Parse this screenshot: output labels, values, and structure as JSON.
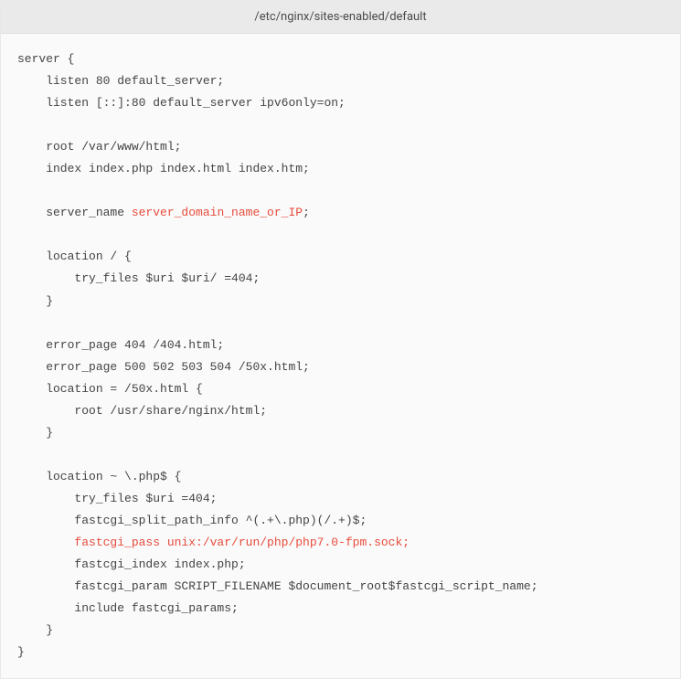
{
  "file_path": "/etc/nginx/sites-enabled/default",
  "code": {
    "line1": "server {",
    "line2": "    listen 80 default_server;",
    "line3": "    listen [::]:80 default_server ipv6only=on;",
    "line4": "",
    "line5": "    root /var/www/html;",
    "line6": "    index index.php index.html index.htm;",
    "line7": "",
    "line8_pre": "    server_name ",
    "line8_hl": "server_domain_name_or_IP",
    "line8_post": ";",
    "line9": "",
    "line10": "    location / {",
    "line11": "        try_files $uri $uri/ =404;",
    "line12": "    }",
    "line13": "",
    "line14": "    error_page 404 /404.html;",
    "line15": "    error_page 500 502 503 504 /50x.html;",
    "line16": "    location = /50x.html {",
    "line17": "        root /usr/share/nginx/html;",
    "line18": "    }",
    "line19": "",
    "line20": "    location ~ \\.php$ {",
    "line21": "        try_files $uri =404;",
    "line22": "        fastcgi_split_path_info ^(.+\\.php)(/.+)$;",
    "line23_hl": "        fastcgi_pass unix:/var/run/php/php7.0-fpm.sock;",
    "line24": "        fastcgi_index index.php;",
    "line25": "        fastcgi_param SCRIPT_FILENAME $document_root$fastcgi_script_name;",
    "line26": "        include fastcgi_params;",
    "line27": "    }",
    "line28": "}"
  }
}
